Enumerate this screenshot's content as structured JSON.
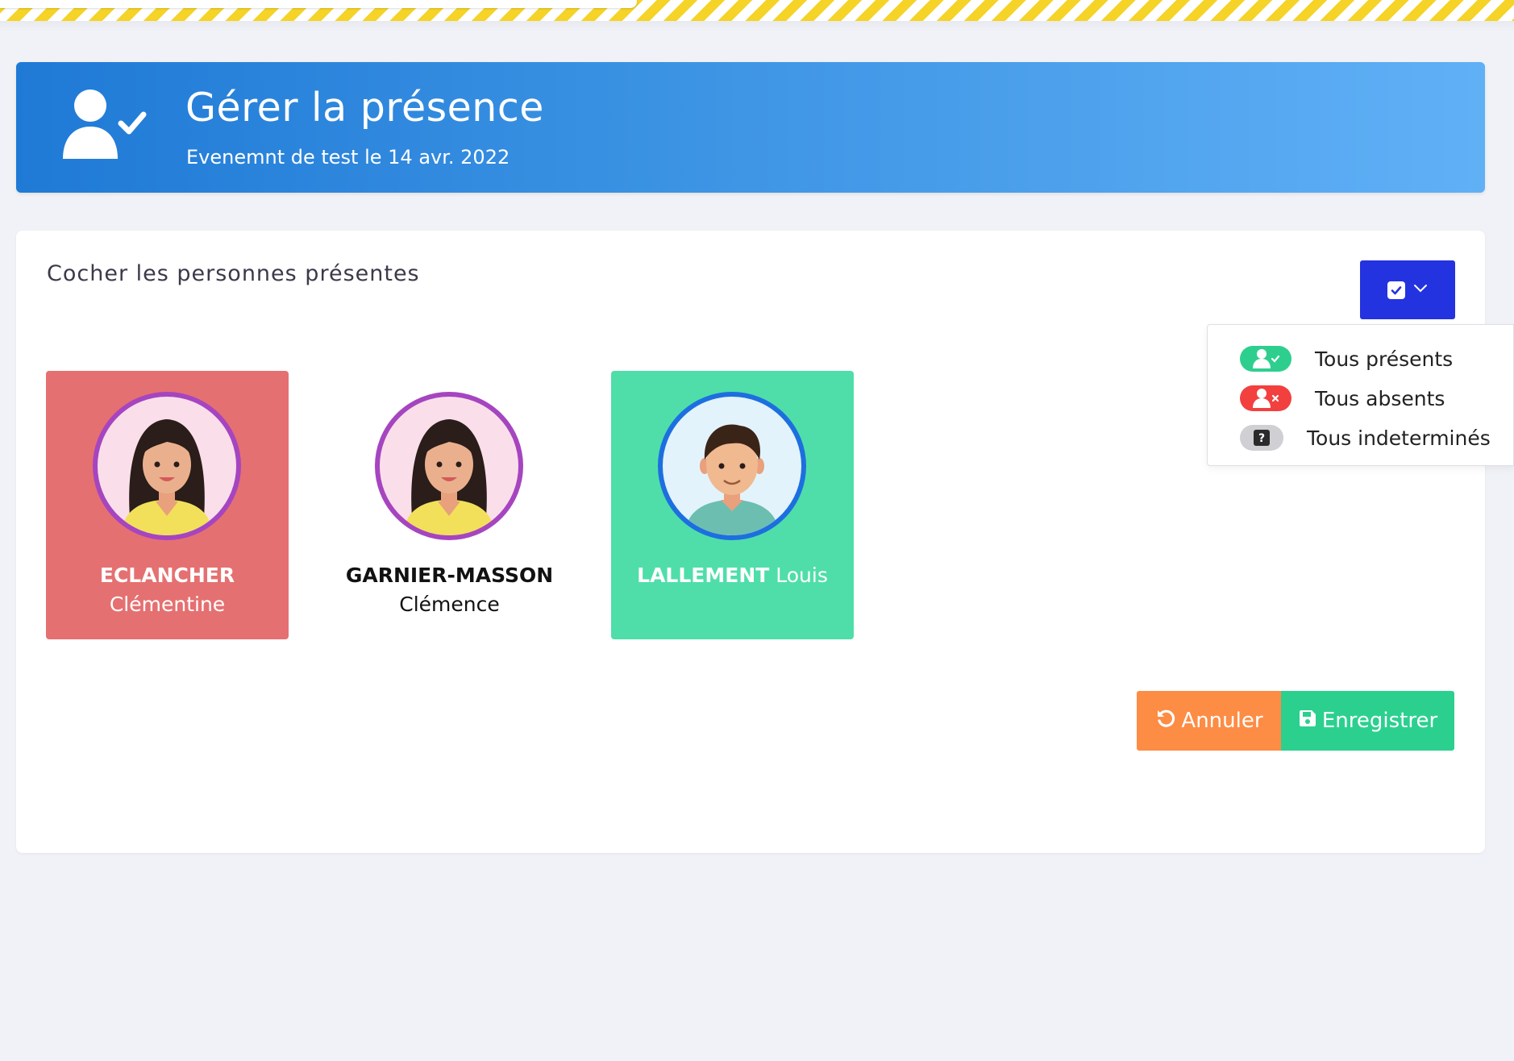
{
  "header": {
    "title": "Gérer la présence",
    "subtitle": "Evenemnt de test le 14 avr. 2022",
    "icon": "user-check-icon"
  },
  "card": {
    "title": "Cocher les personnes présentes",
    "select_toggle_icon": "checkbox-icon"
  },
  "bulk_menu": {
    "items": [
      {
        "label": "Tous présents",
        "icon": "user-check-icon",
        "color": "#2ecf8e"
      },
      {
        "label": "Tous absents",
        "icon": "user-times-icon",
        "color": "#f2403e"
      },
      {
        "label": "Tous indeterminés",
        "icon": "question-icon",
        "color": "#cfcfd4"
      }
    ]
  },
  "people": [
    {
      "lastname": "ECLANCHER",
      "firstname": "Clémentine",
      "status": "absent",
      "bg": "#e57071"
    },
    {
      "lastname": "GARNIER-MASSON",
      "firstname": "Clémence",
      "status": "indeterminate",
      "bg": "#ffffff"
    },
    {
      "lastname": "LALLEMENT",
      "firstname": "Louis",
      "status": "present",
      "bg": "#4fdea9"
    }
  ],
  "actions": {
    "cancel_label": "Annuler",
    "save_label": "Enregistrer",
    "cancel_color": "#fd8c45",
    "save_color": "#2bd08f"
  }
}
